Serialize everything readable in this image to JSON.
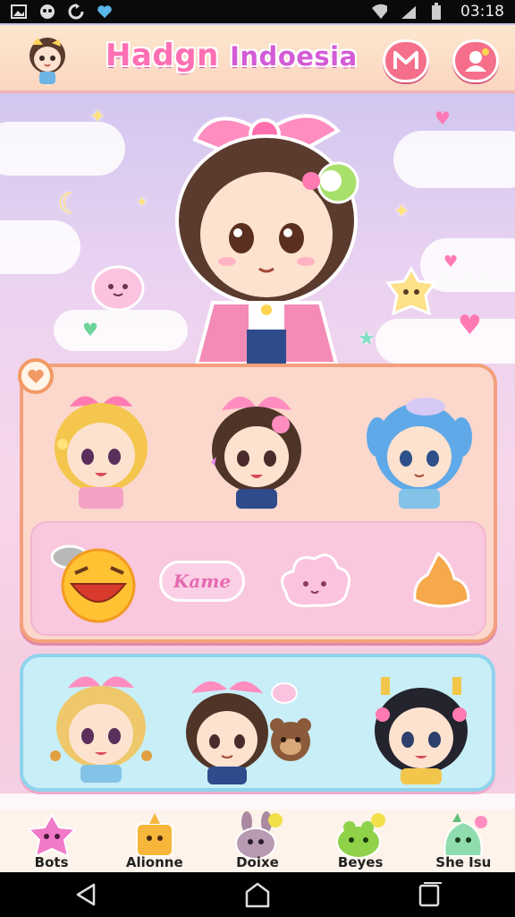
{
  "status_bar": {
    "left_icons": [
      "image-icon",
      "game-controller-icon",
      "sync-icon",
      "heart-icon"
    ],
    "right_icons": [
      "wifi-icon",
      "signal-icon",
      "battery-icon"
    ],
    "time": "03:18"
  },
  "header": {
    "title_main": "Hadgn",
    "title_sub": "Indoesia",
    "buttons": [
      "mail-icon",
      "profile-icon"
    ]
  },
  "emotes_row": {
    "text_badge": "Kame"
  },
  "tabs": [
    {
      "label": "Bots",
      "icon": "pink-star-creature-icon"
    },
    {
      "label": "Alionne",
      "icon": "yellow-star-icon"
    },
    {
      "label": "Doixe",
      "icon": "purple-bunny-icon"
    },
    {
      "label": "Beyes",
      "icon": "green-frog-icon"
    },
    {
      "label": "She Isu",
      "icon": "mint-creature-icon"
    }
  ],
  "navbar": [
    "back-icon",
    "home-icon",
    "recents-icon"
  ],
  "colors": {
    "accent_pink": "#ff6fb3",
    "header_bg": "#fde7cf",
    "panel_pink": "#fbd7cc",
    "panel_blue": "#c8eef7"
  }
}
